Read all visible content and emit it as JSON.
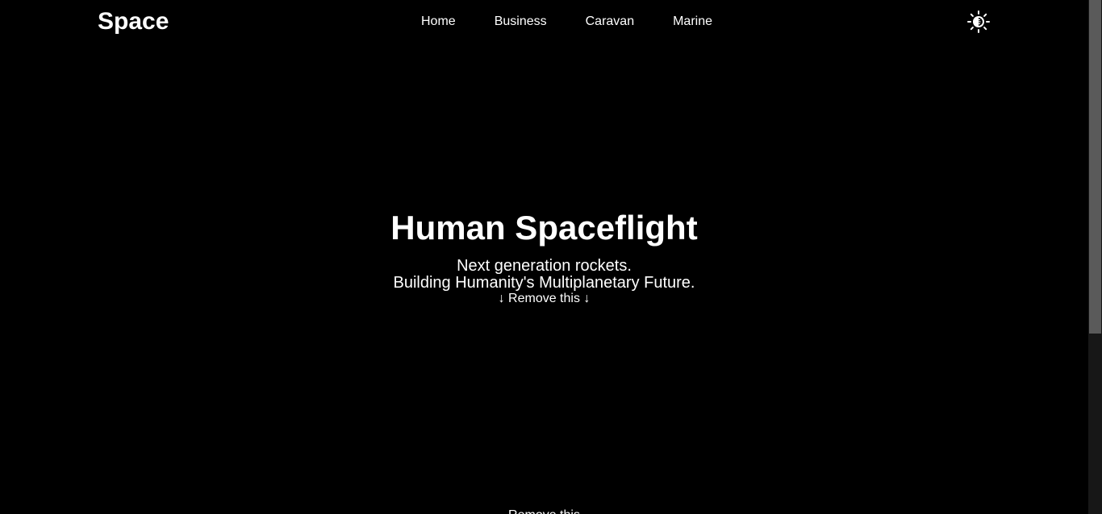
{
  "header": {
    "logo": "Space",
    "nav": [
      "Home",
      "Business",
      "Caravan",
      "Marine"
    ],
    "theme_icon": "sun-icon"
  },
  "hero": {
    "title": "Human Spaceflight",
    "subtitle_line1": "Next generation rockets.",
    "subtitle_line2": "Building Humanity's Multiplanetary Future.",
    "remove_arrow_left": "↓",
    "remove_label": "Remove this",
    "remove_arrow_right": "↓",
    "remove_bottom": "Remove this"
  },
  "colors": {
    "background": "#000000",
    "text": "#ffffff",
    "scrollbar_track": "#171717",
    "scrollbar_thumb": "#5a5a5a"
  }
}
